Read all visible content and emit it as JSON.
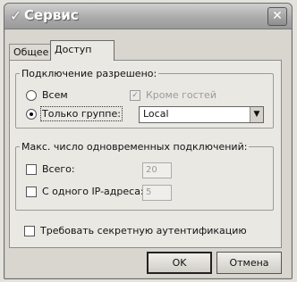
{
  "window": {
    "title": "Сервис",
    "close_glyph": "✕"
  },
  "tabs": [
    {
      "label": "Общее"
    },
    {
      "label": "Доступ"
    }
  ],
  "connection_group": {
    "legend": "Подключение разрешено:",
    "radio_all": "Всем",
    "radio_group_only": "Только группе:",
    "except_guests": "Кроме гостей",
    "group_selected": "Local"
  },
  "limits_group": {
    "legend": "Макс. число одновременных подключений:",
    "total_label": "Всего:",
    "total_value": "20",
    "per_ip_label": "С одного IP-адреса:",
    "per_ip_value": "5"
  },
  "require_secure_auth": "Требовать секретную аутентификацию",
  "buttons": {
    "ok": "OK",
    "cancel": "Отмена"
  }
}
